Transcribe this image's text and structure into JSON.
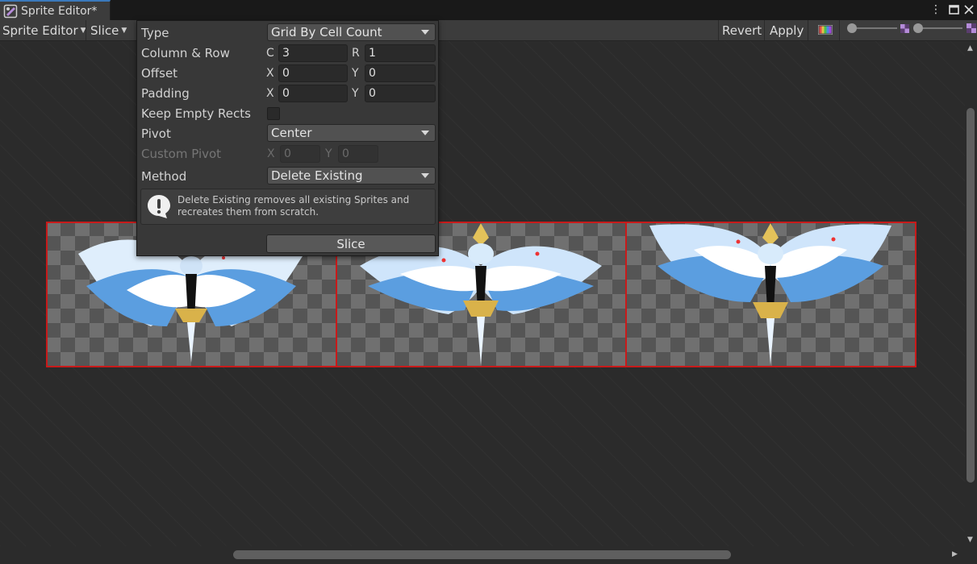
{
  "window": {
    "tab_title": "Sprite Editor*"
  },
  "toolbar": {
    "sprite_editor_menu": "Sprite Editor",
    "slice_menu": "Slice",
    "revert": "Revert",
    "apply": "Apply"
  },
  "slice_popup": {
    "type_label": "Type",
    "type_value": "Grid By Cell Count",
    "column_row_label": "Column & Row",
    "column_axis": "C",
    "column_value": "3",
    "row_axis": "R",
    "row_value": "1",
    "offset_label": "Offset",
    "offset_x_axis": "X",
    "offset_x": "0",
    "offset_y_axis": "Y",
    "offset_y": "0",
    "padding_label": "Padding",
    "padding_x_axis": "X",
    "padding_x": "0",
    "padding_y_axis": "Y",
    "padding_y": "0",
    "keep_empty_rects_label": "Keep Empty Rects",
    "keep_empty_rects_checked": false,
    "pivot_label": "Pivot",
    "pivot_value": "Center",
    "custom_pivot_label": "Custom Pivot",
    "custom_pivot_x_axis": "X",
    "custom_pivot_x": "0",
    "custom_pivot_y_axis": "Y",
    "custom_pivot_y": "0",
    "method_label": "Method",
    "method_value": "Delete Existing",
    "help_text": "Delete Existing removes all existing Sprites and recreates them from scratch.",
    "slice_button": "Slice"
  },
  "sprite_sheet": {
    "cell_count": 3,
    "slice_border_color": "#c81a1a"
  },
  "colors": {
    "accent": "#3a79bb",
    "canvas_bg": "#2b2b2b",
    "panel_bg": "#383838"
  }
}
